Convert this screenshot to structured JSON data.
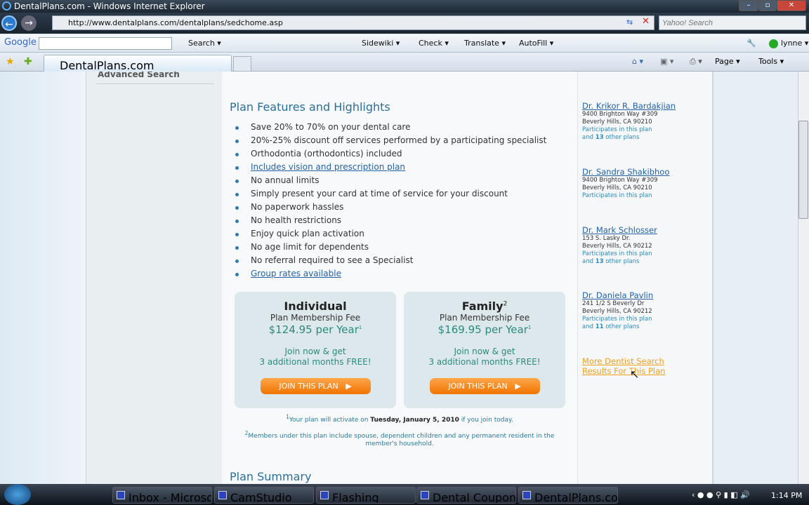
{
  "window": {
    "title": "DentalPlans.com - Windows Internet Explorer",
    "url": "http://www.dentalplans.com/dentalplans/sedchome.asp",
    "search_placeholder": "Yahoo! Search"
  },
  "google_toolbar": {
    "logo": "Google",
    "search": "Search ▾",
    "sidewiki": "Sidewiki ▾",
    "check": "Check ▾",
    "translate": "Translate ▾",
    "autofill": "AutoFill ▾",
    "user": "lynne ▾"
  },
  "tabs": {
    "active": "DentalPlans.com",
    "page": "Page ▾",
    "tools": "Tools ▾"
  },
  "leftnav": {
    "heading": "Advanced Search"
  },
  "main": {
    "features_title": "Plan Features and Highlights",
    "features": [
      {
        "text": "Save 20% to 70% on your dental care",
        "link": false
      },
      {
        "text": "20%-25% discount off services performed by a participating specialist",
        "link": false
      },
      {
        "text": "Orthodontia (orthodontics) included",
        "link": false
      },
      {
        "text": "Includes vision and prescription plan",
        "link": true
      },
      {
        "text": "No annual limits",
        "link": false
      },
      {
        "text": "Simply present your card at time of service for your discount",
        "link": false
      },
      {
        "text": "No paperwork hassles",
        "link": false
      },
      {
        "text": "No health restrictions",
        "link": false
      },
      {
        "text": "Enjoy quick plan activation",
        "link": false
      },
      {
        "text": "No age limit for dependents",
        "link": false
      },
      {
        "text": "No referral required to see a Specialist",
        "link": false
      },
      {
        "text": "Group rates available",
        "link": true
      }
    ],
    "plans": [
      {
        "title": "Individual",
        "sup": "",
        "subtitle": "Plan Membership Fee",
        "price": "$124.95 per Year",
        "price_sup": "1",
        "promo1": "Join now & get",
        "promo2": "3 additional months FREE!",
        "button": "JOIN THIS PLAN"
      },
      {
        "title": "Family",
        "sup": "2",
        "subtitle": "Plan Membership Fee",
        "price": "$169.95 per Year",
        "price_sup": "1",
        "promo1": "Join now & get",
        "promo2": "3 additional months FREE!",
        "button": "JOIN THIS PLAN"
      }
    ],
    "note1_pre": "Your plan will activate on ",
    "note1_date": "Tuesday, January 5, 2010",
    "note1_post": " if you join today.",
    "note2": "Members under this plan include spouse, dependent children and any permanent resident in the member's household.",
    "summary_title": "Plan Summary"
  },
  "dentists": [
    {
      "name": "Dr. Krikor R. Bardakjian",
      "addr1": "9400 Brighton Way #309",
      "addr2": "Beverly Hills, CA  90210",
      "part": "Participates in this plan",
      "other_pre": "and ",
      "other_n": "13",
      "other_post": " other plans"
    },
    {
      "name": "Dr. Sandra Shakibhoo",
      "addr1": "9400 Brighton Way #309",
      "addr2": "Beverly Hills, CA  90210",
      "part": "Participates in this plan"
    },
    {
      "name": "Dr. Mark Schlosser",
      "addr1": "153 S. Lasky Dr.",
      "addr2": "Beverly Hills, CA  90212",
      "part": "Participates in this plan",
      "other_pre": "and ",
      "other_n": "13",
      "other_post": " other plans"
    },
    {
      "name": "Dr. Daniela Pavlin",
      "addr1": "241 1/2 S Beverly Dr",
      "addr2": "Beverly Hills, CA  90212",
      "part": "Participates in this plan",
      "other_pre": "and ",
      "other_n": "11",
      "other_post": " other plans"
    }
  ],
  "more_link": "More Dentist Search Results For This Plan",
  "taskbar": {
    "items": [
      "Inbox - Microsoft O...",
      "CamStudio",
      "Flashing",
      "Dental Coupons an...",
      "DentalPlans.com - ..."
    ],
    "clock": "1:14 PM"
  }
}
